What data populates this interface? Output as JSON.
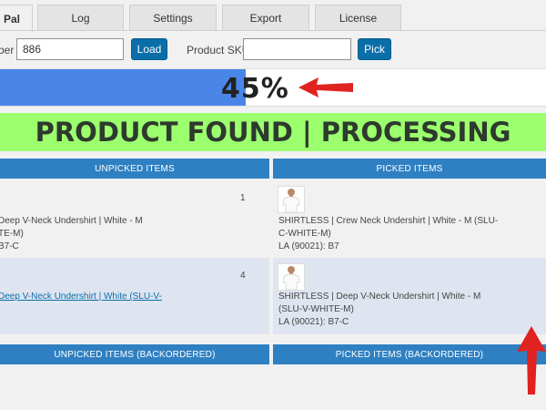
{
  "tabs": [
    {
      "label": "Pal"
    },
    {
      "label": "Log"
    },
    {
      "label": "Settings"
    },
    {
      "label": "Export"
    },
    {
      "label": "License"
    }
  ],
  "form": {
    "order_label": "ber",
    "order_value": "886",
    "load_label": "Load",
    "sku_label": "Product SKU",
    "sku_value": "",
    "pick_label": "Pick"
  },
  "progress": {
    "text": "45%",
    "value": 0.45
  },
  "status": {
    "text": "PRODUCT FOUND | PROCESSING",
    "color": "#9cff6e"
  },
  "sections": {
    "unpicked": "UNPICKED ITEMS",
    "picked": "PICKED ITEMS",
    "unpicked_backordered": "UNPICKED ITEMS (BACKORDERED)",
    "picked_backordered": "PICKED ITEMS (BACKORDERED)"
  },
  "unpicked_items": [
    {
      "qty": "1",
      "line1": "Deep V-Neck Undershirt | White - M",
      "line2": "TE-M)",
      "line3": "B7-C"
    },
    {
      "qty": "4",
      "line1": "Deep V-Neck Undershirt | White (SLU-V-"
    }
  ],
  "picked_items": [
    {
      "line1": "SHIRTLESS | Crew Neck Undershirt | White - M (SLU-",
      "line2": "C-WHITE-M)",
      "line3": "LA (90021): B7"
    },
    {
      "line1": "SHIRTLESS | Deep V-Neck Undershirt | White - M",
      "line2": "(SLU-V-WHITE-M)",
      "line3": "LA (90021): B7-C"
    }
  ],
  "colors": {
    "accent": "#2f80c2",
    "button": "#0a6ea8",
    "progress": "#4a86e8",
    "arrow": "#e0231f"
  },
  "icons": {
    "progress_arrow": "red-arrow-left-icon",
    "scroll_arrow": "red-arrow-up-icon"
  }
}
